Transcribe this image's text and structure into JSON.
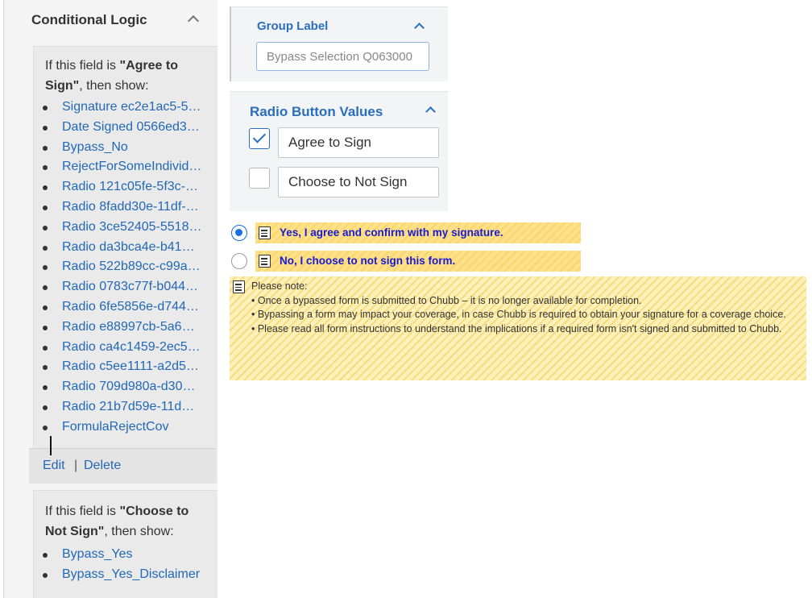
{
  "conditional_logic": {
    "title": "Conditional Logic",
    "rules": [
      {
        "prefix": "If this field is ",
        "value": "\"Agree to Sign\"",
        "suffix": ", then show:",
        "targets": [
          "Signature ec2e1ac5-5…",
          "Date Signed 0566ed3…",
          "Bypass_No",
          "RejectForSomeIndivid…",
          "Radio 121c05fe-5f3c-…",
          "Radio 8fadd30e-11df-…",
          "Radio 3ce52405-5518…",
          "Radio da3bca4e-b41…",
          "Radio 522b89cc-c99a…",
          "Radio 0783c77f-b044…",
          "Radio 6fe5856e-d744…",
          "Radio e88997cb-5a6…",
          "Radio ca4c1459-2ec5…",
          "Radio c5ee1111-a2d5…",
          "Radio 709d980a-d30…",
          "Radio 21b7d59e-11d…",
          "FormulaRejectCov"
        ],
        "edit_label": "Edit",
        "separator": "|",
        "delete_label": "Delete"
      },
      {
        "prefix": "If this field is ",
        "value": "\"Choose to Not Sign\"",
        "suffix": ", then show:",
        "targets": [
          "Bypass_Yes",
          "Bypass_Yes_Disclaimer"
        ]
      }
    ]
  },
  "group_label": {
    "title": "Group Label",
    "value": "Bypass Selection Q063000"
  },
  "radio_button_values": {
    "title": "Radio Button Values",
    "values": [
      {
        "label": "Agree to Sign",
        "checked": true
      },
      {
        "label": "Choose to Not Sign",
        "checked": false
      }
    ]
  },
  "preview": {
    "options": [
      {
        "label": "Yes, I agree and confirm with my signature.",
        "selected": true
      },
      {
        "label": "No, I choose to not sign this form.",
        "selected": false
      }
    ],
    "note_lines": [
      "Please note:",
      "• Once a bypassed form is submitted to Chubb – it is no longer available for completion.",
      "• Bypassing a form may impact your coverage, in case Chubb is required to obtain your signature for a coverage choice.",
      "• Please read all form instructions to understand the implications if a required form isn't signed and submitted to Chubb."
    ]
  },
  "colors": {
    "link": "#2268b6",
    "accent": "#2a6ebe",
    "option_text": "#1a1ad0",
    "highlight": "#fde08a"
  },
  "icons": [
    "chevron-up-icon",
    "checkbox-icon",
    "radio-icon",
    "note-icon"
  ]
}
